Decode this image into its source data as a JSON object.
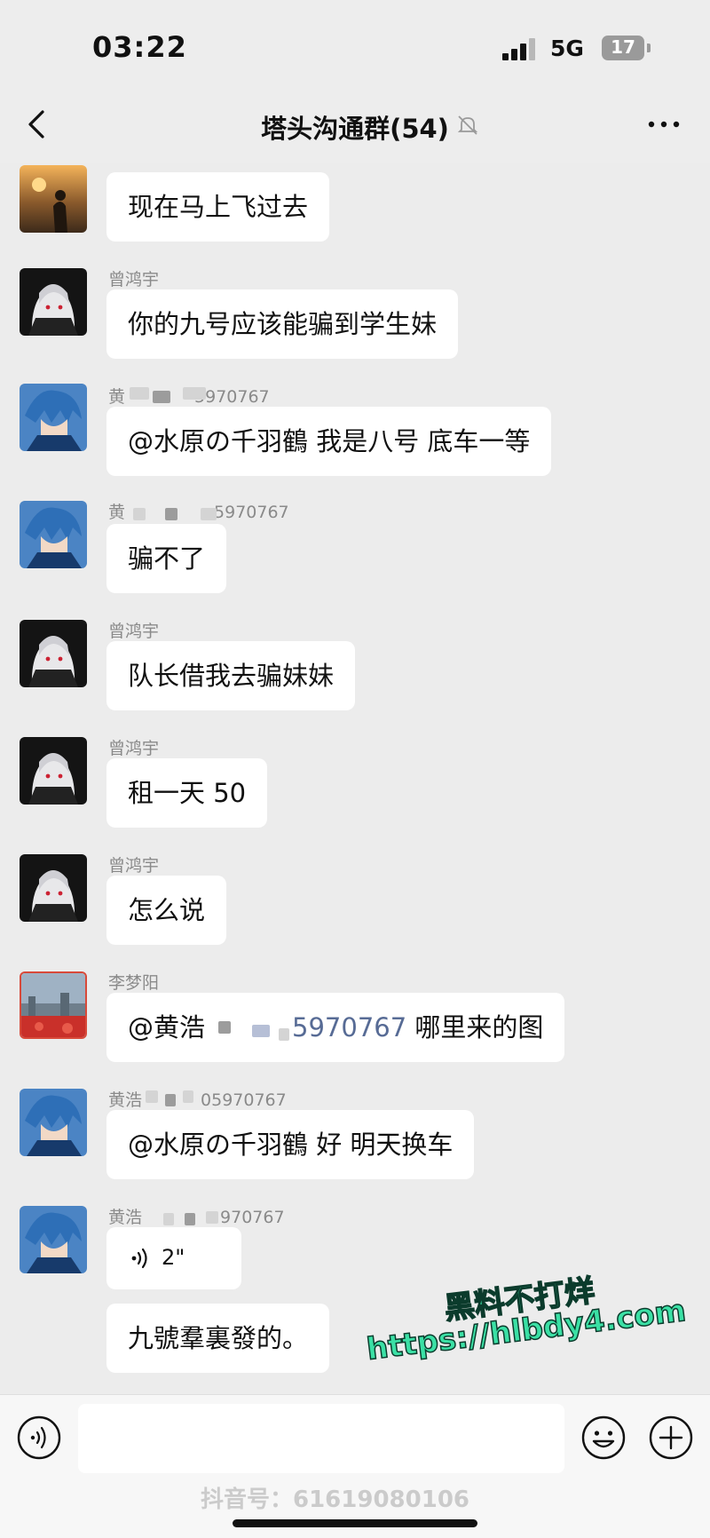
{
  "status_bar": {
    "time": "03:22",
    "network": "5G",
    "battery": "17"
  },
  "header": {
    "title": "塔头沟通群(54)"
  },
  "messages": [
    {
      "sender": "",
      "text": "现在马上飞过去"
    },
    {
      "sender": "曾鸿宇",
      "text": "你的九号应该能骗到学生妹"
    },
    {
      "sender_prefix": "黄",
      "sender_suffix": "5970767",
      "text": "@水原の千羽鶴 我是八号 底车一等"
    },
    {
      "sender_prefix": "黄",
      "sender_suffix": "5970767",
      "text": "骗不了"
    },
    {
      "sender": "曾鸿宇",
      "text": "队长借我去骗妹妹"
    },
    {
      "sender": "曾鸿宇",
      "text": "租一天 50"
    },
    {
      "sender": "曾鸿宇",
      "text": "怎么说"
    },
    {
      "sender": "李梦阳",
      "text_prefix": "@黄浩",
      "text_link": "5970767",
      "text_suffix": " 哪里来的图"
    },
    {
      "sender_prefix": "黄浩",
      "sender_suffix": "05970767",
      "text": "@水原の千羽鶴 好 明天换车"
    },
    {
      "sender_prefix": "黄浩",
      "sender_suffix": "970767",
      "voice_duration": "2\"",
      "text": "九號羣裏發的。"
    }
  ],
  "input": {
    "placeholder": ""
  },
  "watermarks": {
    "title": "黑料不打烊",
    "url": "https://hlbdy4.com",
    "tiktok": "抖音号：61619080106"
  }
}
